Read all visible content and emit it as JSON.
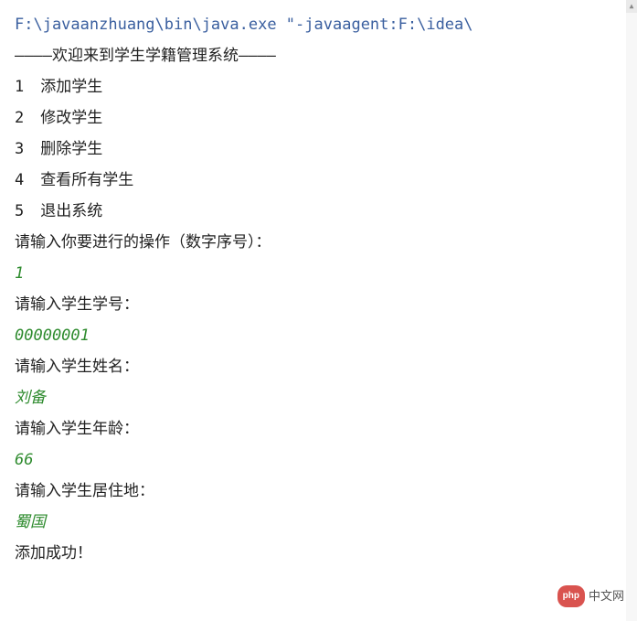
{
  "command": "F:\\javaanzhuang\\bin\\java.exe \"-javaagent:F:\\idea\\",
  "header": "————欢迎来到学生学籍管理系统————",
  "menu": [
    {
      "num": "1",
      "label": "添加学生"
    },
    {
      "num": "2",
      "label": "修改学生"
    },
    {
      "num": "3",
      "label": "删除学生"
    },
    {
      "num": "4",
      "label": "查看所有学生"
    },
    {
      "num": "5",
      "label": "退出系统"
    }
  ],
  "prompts": {
    "action": "请输入你要进行的操作（数字序号）：",
    "id": "请输入学生学号：",
    "name": "请输入学生姓名：",
    "age": "请输入学生年龄：",
    "address": "请输入学生居住地："
  },
  "inputs": {
    "action": "1",
    "id": "00000001",
    "name": "刘备",
    "age": "66",
    "address": "蜀国"
  },
  "result": "添加成功！",
  "watermark": {
    "badge": "php",
    "text": "中文网"
  }
}
